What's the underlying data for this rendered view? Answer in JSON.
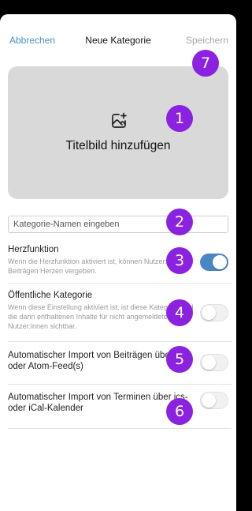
{
  "header": {
    "cancel_label": "Abbrechen",
    "title": "Neue Kategorie",
    "save_label": "Speichern"
  },
  "cover": {
    "label": "Titelbild hinzufügen",
    "icon": "add-image-icon"
  },
  "name_input": {
    "placeholder": "Kategorie-Namen eingeben",
    "value": ""
  },
  "settings": [
    {
      "title": "Herzfunktion",
      "description": "Wenn die Herzfunktion aktiviert ist, können Nutzer:innen Beiträgen Herzen vergeben.",
      "enabled": true
    },
    {
      "title": "Öffentliche Kategorie",
      "description": "Wenn diese Einstellung aktiviert ist, ist diese Kategorie und die darin enthaltenen Inhalte für nicht angemeldete Nutzer:innen sichtbar.",
      "enabled": false
    },
    {
      "title": "Automatischer Import von Beiträgen über rss- oder Atom-Feed(s)",
      "description": "",
      "enabled": false
    },
    {
      "title": "Automatischer Import von Terminen über ics- oder iCal-Kalender",
      "description": "",
      "enabled": false
    }
  ],
  "badges": [
    "1",
    "2",
    "3",
    "4",
    "5",
    "6",
    "7"
  ],
  "colors": {
    "accent": "#4a86c4",
    "link": "#4a8fc8",
    "badge": "#8a22e0",
    "cover_bg": "#d9d9d9"
  }
}
